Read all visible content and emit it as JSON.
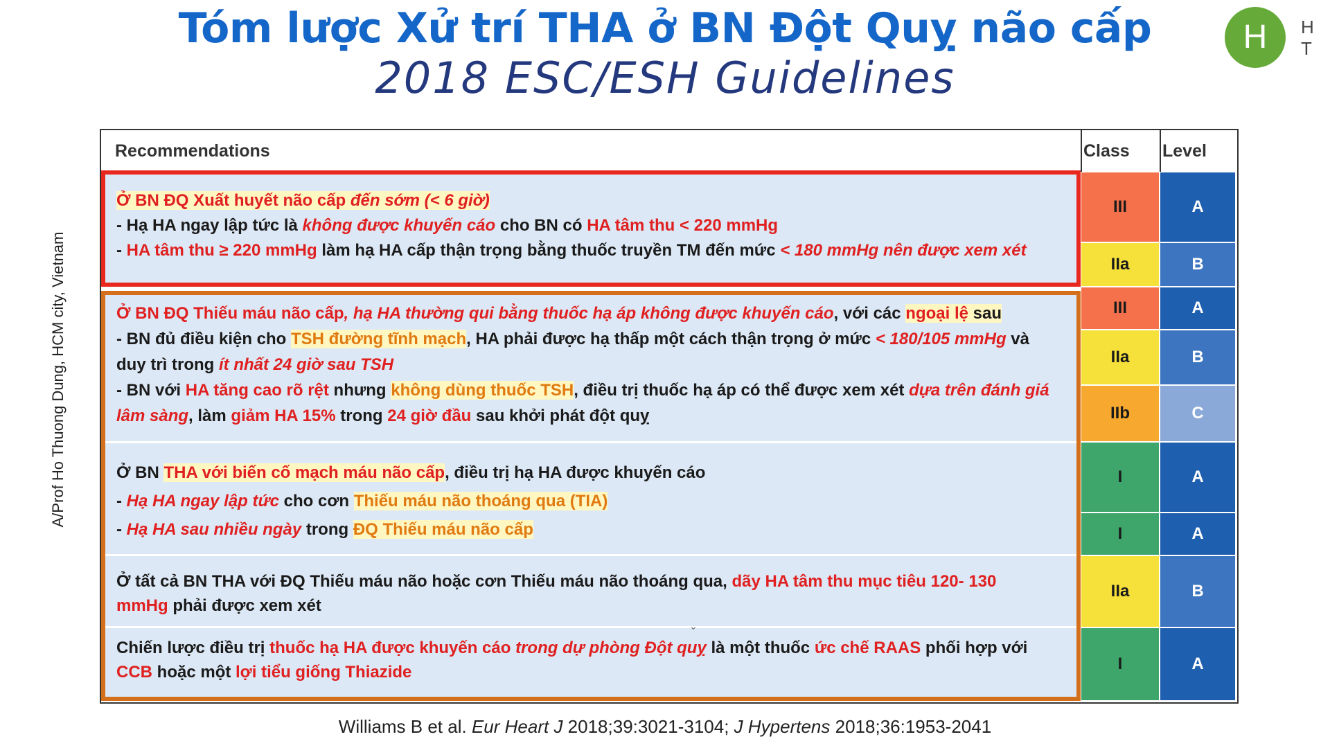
{
  "header": {
    "title": "Tóm lược Xử trí THA ở BN Đột Quỵ não cấp",
    "subtitle": "2018 ESC/ESH Guidelines"
  },
  "avatar": {
    "initial": "H",
    "label": "H T"
  },
  "side_credit": "A/Prof Ho Thuong Dung, HCM city, Vietnam",
  "table": {
    "col_recommendations": "Recommendations",
    "col_class": "Class",
    "col_level": "Level",
    "rows": [
      {
        "line1_a": "Ở BN ĐQ Xuất huyết não cấp ",
        "line1_b": "đến sớm (< 6 giờ)",
        "line2_a": "- Hạ HA ngay lập tức là ",
        "line2_b": "không được khuyến cáo",
        "line2_c": " cho BN có ",
        "line2_d": "HA tâm thu < 220 mmHg",
        "line3_a": "- ",
        "line3_b": "HA tâm thu ≥ 220 mmHg",
        "line3_c": " làm hạ HA cấp thận trọng bằng thuốc truyền TM đến mức ",
        "line3_d": "< 180 mmHg nên được xem xét"
      },
      {
        "line1_a": "Ở BN ĐQ Thiếu máu não cấp",
        "line1_b": ", hạ HA thường qui bằng thuốc hạ áp không được khuyến cáo",
        "line1_c": ", với các ",
        "line1_d": "ngoại lệ",
        "line1_e": " sau",
        "line2_a": "- BN đủ điều kiện cho ",
        "line2_b": "TSH đường tĩnh mạch",
        "line2_c": ", HA phải được hạ thấp một cách thận trọng ở mức ",
        "line2_d": "< 180/105 mmHg",
        "line2_e": " và",
        "line3_a": "duy trì trong ",
        "line3_b": "ít nhất 24 giờ sau TSH",
        "line4_a": "- BN với ",
        "line4_b": "HA tăng cao rõ rệt",
        "line4_c": " nhưng ",
        "line4_d": "không dùng thuốc TSH",
        "line4_e": ", điều trị thuốc hạ áp có thể được xem xét ",
        "line4_f": "dựa trên đánh giá",
        "line5_a": "lâm sàng",
        "line5_b": ", làm ",
        "line5_c": "giảm HA 15%",
        "line5_d": " trong ",
        "line5_e": "24 giờ đầu",
        "line5_f": " sau khởi phát đột quỵ"
      },
      {
        "line1_a": "Ở BN ",
        "line1_b": "THA với biến cố mạch máu não cấp",
        "line1_c": ", điều trị hạ HA được khuyến cáo",
        "line2_a": "- ",
        "line2_b": "Hạ HA ngay lập tức",
        "line2_c": " cho cơn ",
        "line2_d": "Thiếu máu não thoáng qua (TIA)",
        "line3_a": "- ",
        "line3_b": "Hạ HA sau nhiều ngày",
        "line3_c": " trong ",
        "line3_d": "ĐQ Thiếu máu não cấp"
      },
      {
        "line1_a": "Ở tất cả BN THA với ĐQ Thiếu máu não hoặc cơn Thiếu máu não thoáng qua, ",
        "line1_b": "dãy HA tâm thu mục tiêu 120- 130",
        "line2_a": "mmHg",
        "line2_b": " phải được xem xét"
      },
      {
        "line1_a": "Chiến lược điều trị ",
        "line1_b": "thuốc hạ HA được khuyến cáo ",
        "line1_c": "trong dự phòng Đột quỵ",
        "line1_d": " là một thuốc ",
        "line1_e": "ức chế RAAS",
        "line1_f": " phối hợp  với",
        "line2_a": "CCB",
        "line2_b": " hoặc một ",
        "line2_c": "lợi tiểu giống Thiazide"
      }
    ],
    "grades": [
      {
        "class": "III",
        "level": "A",
        "class_color": "#f4714c",
        "level_color": "#1f5fb0"
      },
      {
        "class": "IIa",
        "level": "B",
        "class_color": "#f6e13a",
        "level_color": "#3e75c0"
      },
      {
        "class": "III",
        "level": "A",
        "class_color": "#f4714c",
        "level_color": "#1f5fb0"
      },
      {
        "class": "IIa",
        "level": "B",
        "class_color": "#f6e13a",
        "level_color": "#3e75c0"
      },
      {
        "class": "IIb",
        "level": "C",
        "class_color": "#f7a82e",
        "level_color": "#8aa8d8"
      },
      {
        "class": "I",
        "level": "A",
        "class_color": "#3ea56b",
        "level_color": "#1f5fb0"
      },
      {
        "class": "I",
        "level": "A",
        "class_color": "#3ea56b",
        "level_color": "#1f5fb0"
      },
      {
        "class": "IIa",
        "level": "B",
        "class_color": "#f6e13a",
        "level_color": "#3e75c0"
      },
      {
        "class": "I",
        "level": "A",
        "class_color": "#3ea56b",
        "level_color": "#1f5fb0"
      }
    ]
  },
  "footer": {
    "a": "Williams B et al. ",
    "b": "Eur Heart J",
    "c": " 2018;39:3021-3104; ",
    "d": "J Hypertens",
    "e": " 2018;36:1953-2041"
  }
}
